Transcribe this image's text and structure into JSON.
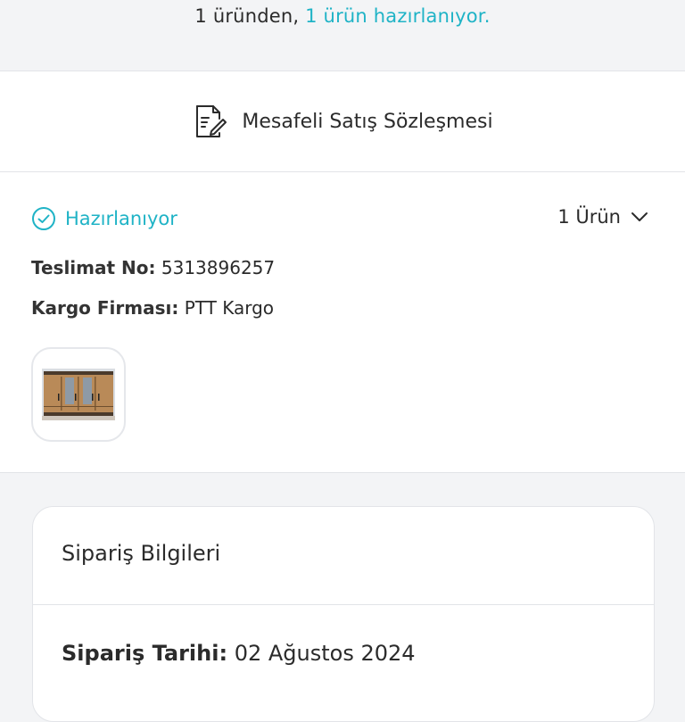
{
  "summary": {
    "prefix": "1 üründen, ",
    "highlight": "1 ürün hazırlanıyor."
  },
  "contract": {
    "label": "Mesafeli Satış Sözleşmesi",
    "icon": "document-edit-icon"
  },
  "shipment": {
    "status_label": "Hazırlanıyor",
    "status_icon": "check-circle-icon",
    "item_count_label": "1 Ürün",
    "delivery_no_key": "Teslimat No:",
    "delivery_no_value": "5313896257",
    "carrier_key": "Kargo Firması:",
    "carrier_value": "PTT Kargo",
    "product_image": "wardrobe-thumbnail"
  },
  "order_info": {
    "title": "Sipariş Bilgileri",
    "date_key": "Sipariş Tarihi:",
    "date_value": "02 Ağustos 2024"
  },
  "colors": {
    "accent": "#1fb3c6",
    "background": "#f3f4f6",
    "text": "#2b2b2b"
  }
}
